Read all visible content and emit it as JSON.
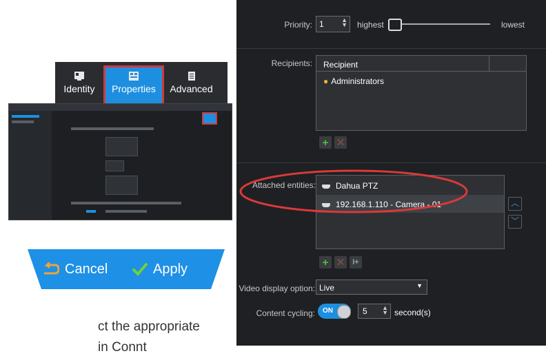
{
  "tabs": {
    "identity": "Identity",
    "properties": "Properties",
    "advanced": "Advanced"
  },
  "actions": {
    "cancel": "Cancel",
    "apply": "Apply"
  },
  "caption": {
    "line1": "ct the appropriate",
    "line2": "in Connt"
  },
  "properties_panel": {
    "priority": {
      "label": "Priority:",
      "value": "1",
      "low_end": "highest",
      "high_end": "lowest"
    },
    "recipients": {
      "label": "Recipients:",
      "column": "Recipient",
      "items": [
        "Administrators"
      ]
    },
    "attached_entities": {
      "label": "Attached entities:",
      "items": [
        "Dahua PTZ",
        "192.168.1.110 - Camera - 01"
      ],
      "extra_button": "I+"
    },
    "video_display": {
      "label": "Video display option:",
      "value": "Live"
    },
    "content_cycling": {
      "label": "Content cycling:",
      "toggle": "ON",
      "value": "5",
      "unit": "second(s)"
    }
  },
  "colors": {
    "accent_blue": "#1e90e6",
    "highlight_red": "#d23a3a",
    "panel_bg": "#1f2023"
  }
}
